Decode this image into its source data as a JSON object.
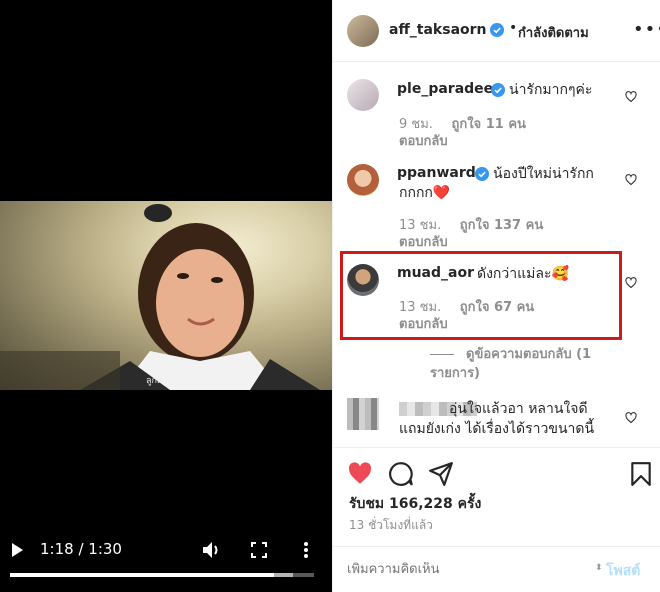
{
  "video": {
    "time": "1:18 / 1:30",
    "caption_overlay": "ลูกสาว",
    "progress": 0.867,
    "buffered": 0.93
  },
  "post": {
    "username": "aff_taksaorn",
    "dot": "•",
    "follow_label": "กำลังติดตาม",
    "more": "•••"
  },
  "comments": [
    {
      "user": "ple_paradee",
      "text": "น่ารักมากๆค่ะ",
      "time": "9 ชม.",
      "likes": "ถูกใจ 11 คน",
      "reply": "ตอบกลับ"
    },
    {
      "user": "ppanward",
      "text_line1": "น้องปีใหม่น่ารักก",
      "text_line2": "กกกก❤️",
      "time": "13 ชม.",
      "likes": "ถูกใจ 137 คน",
      "reply": "ตอบกลับ"
    },
    {
      "user": "muad_aor",
      "text": "ดังกว่าแม่ละ🥰",
      "time": "13 ชม.",
      "likes": "ถูกใจ 67 คน",
      "reply": "ตอบกลับ"
    },
    {
      "text_line1": "อุ่นใจแล้วอา หลานใจดี",
      "text_line2": "แถมยังเก่ง ได้เรื่องได้ราวขนาดนี้"
    }
  ],
  "view_replies": "ดูข้อความตอบกลับ (1 รายการ)",
  "stats": {
    "views": "รับชม 166,228 ครั้ง",
    "posted": "13 ชั่วโมงที่แล้ว"
  },
  "composer": {
    "placeholder": "เพิ่มความคิดเห็น",
    "post_label": "โพสต์"
  },
  "colors": {
    "verified": "#3897f0",
    "like": "#ed4956",
    "highlight": "#d0191b"
  }
}
